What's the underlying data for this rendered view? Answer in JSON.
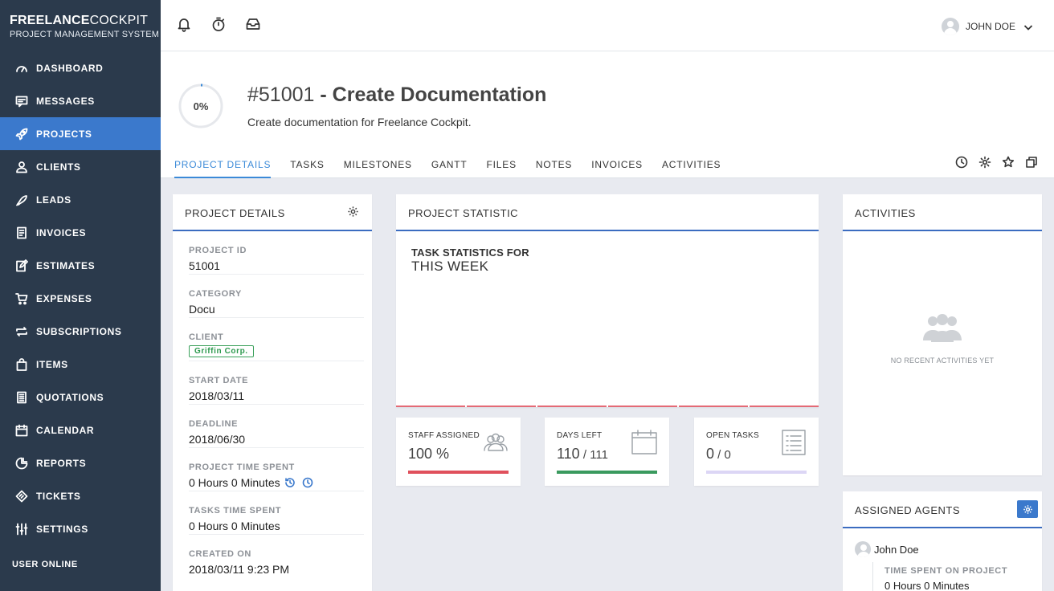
{
  "brand": {
    "title_bold": "FREELANCE",
    "title_light": "COCKPIT",
    "subtitle": "PROJECT MANAGEMENT SYSTEM"
  },
  "nav": [
    {
      "label": "DASHBOARD",
      "icon": "speedometer-icon",
      "active": false
    },
    {
      "label": "MESSAGES",
      "icon": "messages-icon",
      "active": false
    },
    {
      "label": "PROJECTS",
      "icon": "rocket-icon",
      "active": true
    },
    {
      "label": "CLIENTS",
      "icon": "user-icon",
      "active": false
    },
    {
      "label": "LEADS",
      "icon": "leads-icon",
      "active": false
    },
    {
      "label": "INVOICES",
      "icon": "invoice-icon",
      "active": false
    },
    {
      "label": "ESTIMATES",
      "icon": "estimate-icon",
      "active": false
    },
    {
      "label": "EXPENSES",
      "icon": "cart-icon",
      "active": false
    },
    {
      "label": "SUBSCRIPTIONS",
      "icon": "repeat-icon",
      "active": false
    },
    {
      "label": "ITEMS",
      "icon": "bag-icon",
      "active": false
    },
    {
      "label": "QUOTATIONS",
      "icon": "quotation-icon",
      "active": false
    },
    {
      "label": "CALENDAR",
      "icon": "calendar-icon",
      "active": false
    },
    {
      "label": "REPORTS",
      "icon": "reports-icon",
      "active": false
    },
    {
      "label": "TICKETS",
      "icon": "ticket-icon",
      "active": false
    },
    {
      "label": "SETTINGS",
      "icon": "sliders-icon",
      "active": false
    }
  ],
  "user_online": "USER ONLINE",
  "topbar": {
    "user_name": "JOHN DOE"
  },
  "project": {
    "progress": "0%",
    "progress_value": 0,
    "number": "#51001",
    "separator": " - ",
    "name": "Create Documentation",
    "description": "Create documentation for Freelance Cockpit."
  },
  "tabs": [
    "PROJECT DETAILS",
    "TASKS",
    "MILESTONES",
    "GANTT",
    "FILES",
    "NOTES",
    "INVOICES",
    "ACTIVITIES"
  ],
  "details_card": {
    "title": "PROJECT DETAILS",
    "items": [
      {
        "label": "PROJECT ID",
        "value": "51001"
      },
      {
        "label": "CATEGORY",
        "value": "Docu"
      },
      {
        "label": "CLIENT",
        "value": "Griffin Corp."
      },
      {
        "label": "START DATE",
        "value": "2018/03/11"
      },
      {
        "label": "DEADLINE",
        "value": "2018/06/30"
      },
      {
        "label": "PROJECT TIME SPENT",
        "value": "0 Hours 0 Minutes"
      },
      {
        "label": "TASKS TIME SPENT",
        "value": "0 Hours 0 Minutes"
      },
      {
        "label": "CREATED ON",
        "value": "2018/03/11 9:23 PM"
      }
    ]
  },
  "stat_card": {
    "title": "PROJECT STATISTIC",
    "line1": "TASK STATISTICS FOR",
    "line2": "THIS WEEK"
  },
  "mini_stats": [
    {
      "label": "STAFF ASSIGNED",
      "value": "100 %",
      "value_main": "100 %",
      "value_sub": "",
      "color": "#e0505c",
      "icon": "users-icon"
    },
    {
      "label": "DAYS LEFT",
      "value_main": "110",
      "value_sub": " / 111",
      "color": "#3a9a5e",
      "icon": "calendar-icon"
    },
    {
      "label": "OPEN TASKS",
      "value_main": "0",
      "value_sub": " / 0",
      "color": "#dcd6f5",
      "icon": "list-icon"
    }
  ],
  "activities_card": {
    "title": "ACTIVITIES",
    "empty_text": "NO RECENT ACTIVITIES YET"
  },
  "agents_card": {
    "title": "ASSIGNED AGENTS",
    "agent_name": "John Doe",
    "time_label": "TIME SPENT ON PROJECT",
    "time_value": "0 Hours 0 Minutes"
  },
  "colors": {
    "sidebar": "#2b3a4c",
    "active": "#3b79cc",
    "accent": "#3b6cc0"
  }
}
